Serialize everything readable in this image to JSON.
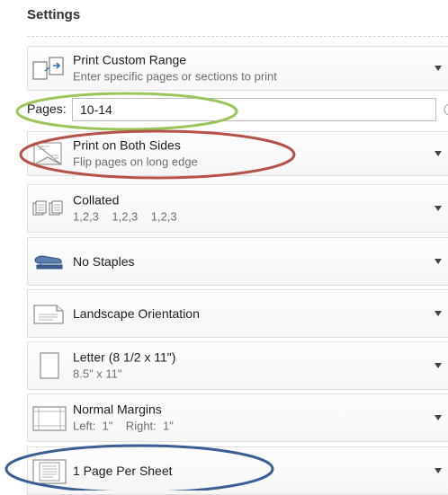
{
  "settings": {
    "title": "Settings",
    "print_range": {
      "label": "Print Custom Range",
      "sublabel": "Enter specific pages or sections to print",
      "icon": "custom-range-icon"
    },
    "pages": {
      "label": "Pages:",
      "value": "10-14",
      "icon": "info-icon"
    },
    "duplex": {
      "label": "Print on Both Sides",
      "sublabel": "Flip pages on long edge",
      "icon": "duplex-icon"
    },
    "collation": {
      "label": "Collated",
      "sublabel": "1,2,3    1,2,3    1,2,3",
      "icon": "collated-icon"
    },
    "stapling": {
      "label": "No Staples",
      "icon": "stapler-icon"
    },
    "orientation": {
      "label": "Landscape Orientation",
      "icon": "landscape-page-icon"
    },
    "paper_size": {
      "label": "Letter (8 1/2 x 11\")",
      "sublabel": "8.5\" x 11\"",
      "icon": "letter-page-icon"
    },
    "margins": {
      "label": "Normal Margins",
      "sublabel": "Left:  1\"    Right:  1\"",
      "icon": "margins-icon"
    },
    "pages_per_sheet": {
      "label": "1 Page Per Sheet",
      "icon": "page-per-sheet-icon"
    }
  },
  "annotations": {
    "green": "#9bc45a",
    "red": "#b5524a",
    "blue": "#3b5f94"
  }
}
